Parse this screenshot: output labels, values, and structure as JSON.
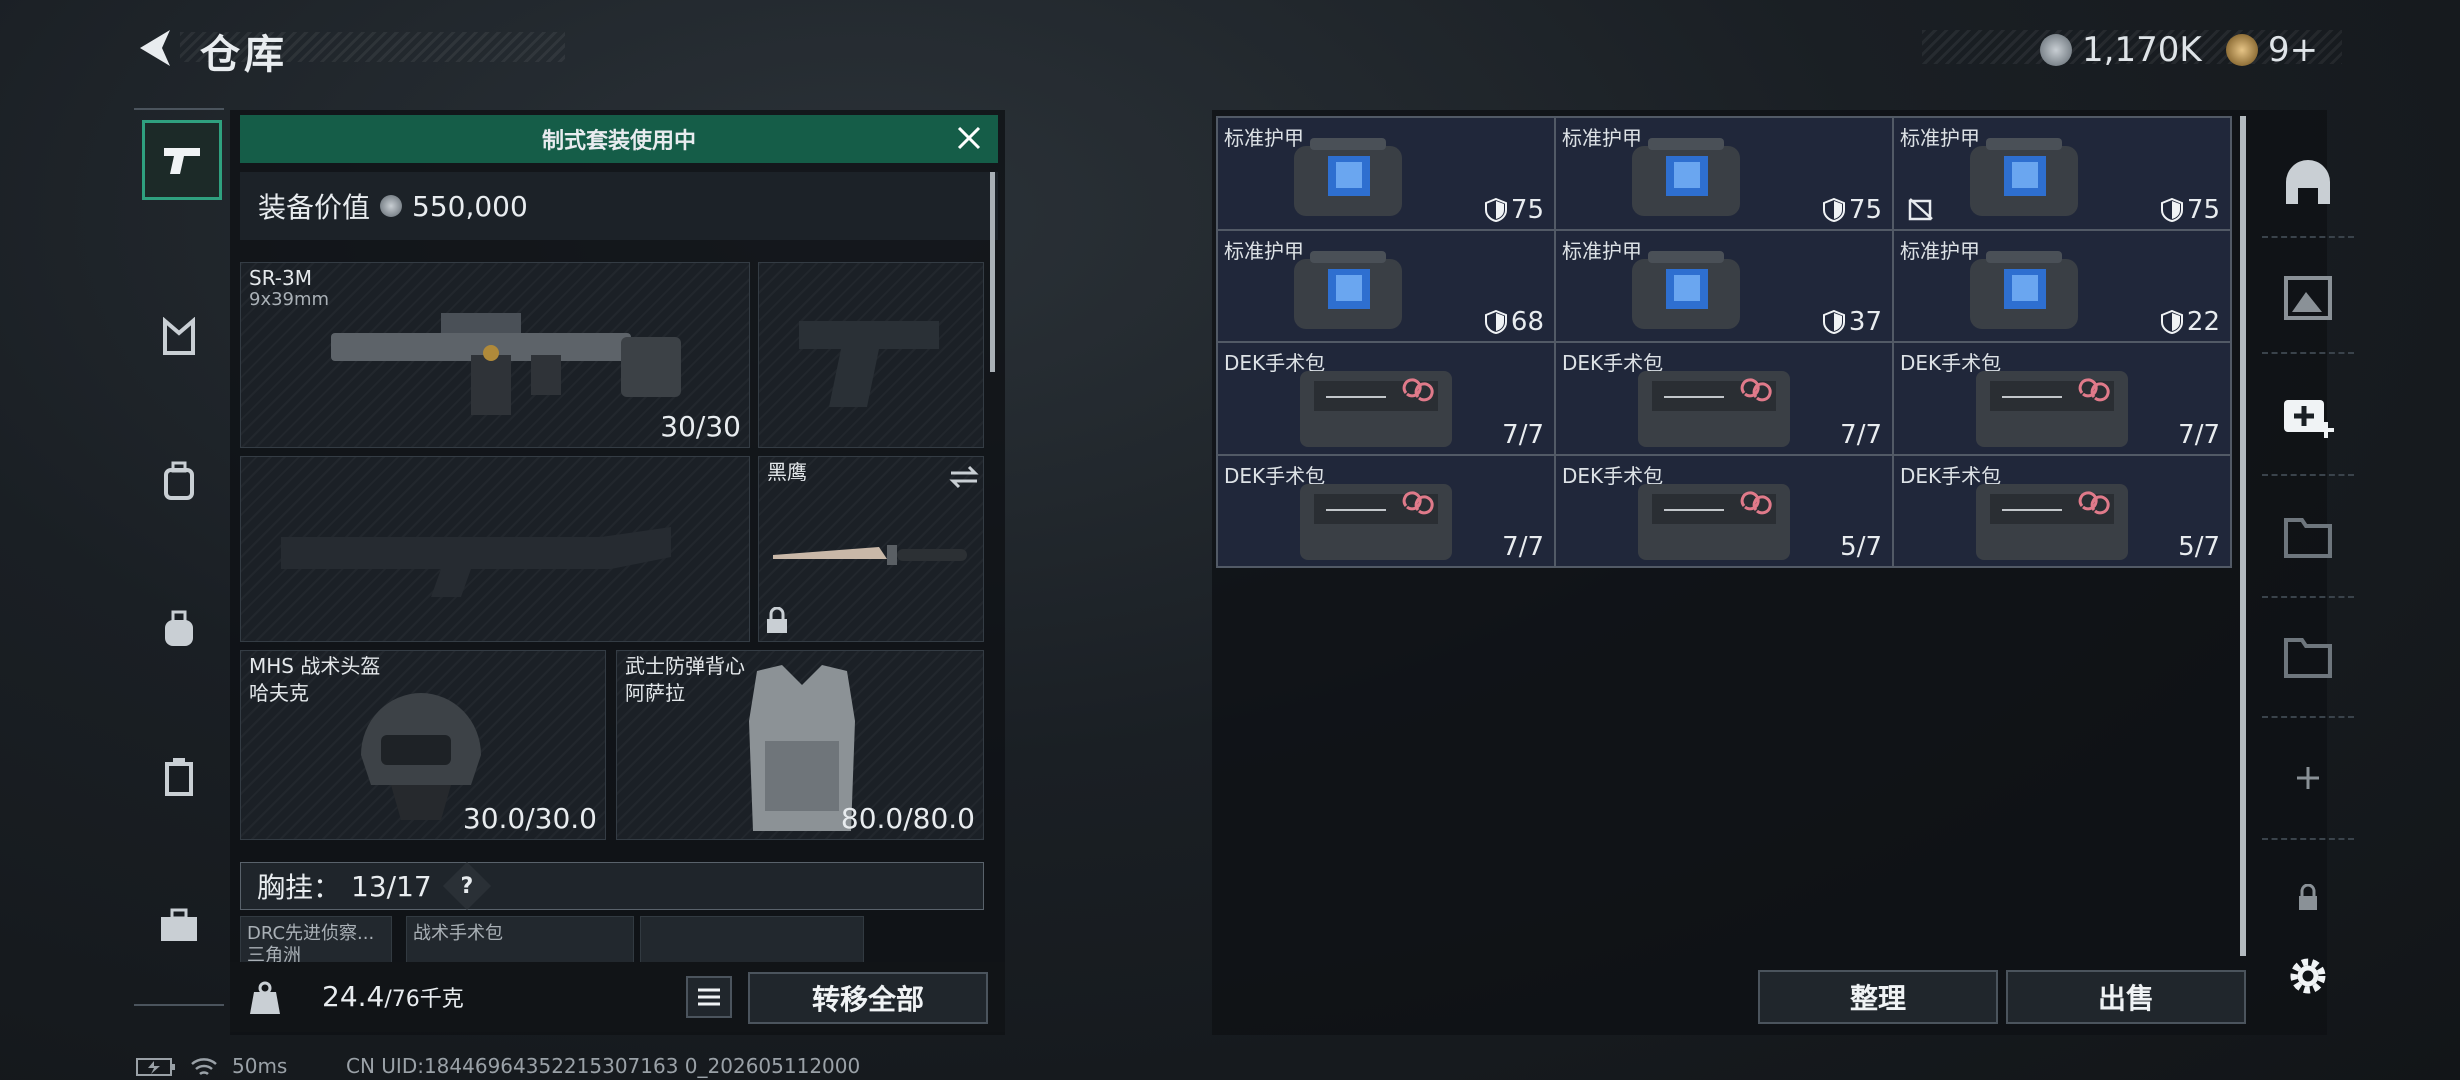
{
  "header": {
    "title": "仓库",
    "currency_amount": "1,170K",
    "token_count": "9+"
  },
  "loadout": {
    "banner": "制式套装使用中",
    "value_label": "装备价值",
    "value": "550,000",
    "primary": {
      "name": "SR-3M",
      "caliber": "9x39mm",
      "ammo": "30/30"
    },
    "melee": {
      "name": "黑鹰"
    },
    "helmet": {
      "line1": "MHS 战术头盔",
      "line2": "哈夫克",
      "durability": "30.0/30.0"
    },
    "armor": {
      "line1": "武士防弹背心",
      "line2": "阿萨拉",
      "durability": "80.0/80.0"
    },
    "chest_rig": {
      "label": "胸挂：",
      "count": "13/17",
      "help": "?"
    },
    "rig_items": [
      "DRC先进侦察...",
      "战术手术包"
    ],
    "rig_sub": "三角洲",
    "weight_current": "24.4",
    "weight_max": "/76千克",
    "transfer_button": "转移全部"
  },
  "stash": {
    "items": [
      {
        "name": "标准护甲",
        "type": "armor",
        "value": "75",
        "extra_icon": false
      },
      {
        "name": "标准护甲",
        "type": "armor",
        "value": "75",
        "extra_icon": false
      },
      {
        "name": "标准护甲",
        "type": "armor",
        "value": "75",
        "extra_icon": true
      },
      {
        "name": "标准护甲",
        "type": "armor",
        "value": "68",
        "extra_icon": false
      },
      {
        "name": "标准护甲",
        "type": "armor",
        "value": "37",
        "extra_icon": false
      },
      {
        "name": "标准护甲",
        "type": "armor",
        "value": "22",
        "extra_icon": false
      },
      {
        "name": "DEK手术包",
        "type": "medkit",
        "value": "7/7",
        "extra_icon": false
      },
      {
        "name": "DEK手术包",
        "type": "medkit",
        "value": "7/7",
        "extra_icon": false
      },
      {
        "name": "DEK手术包",
        "type": "medkit",
        "value": "7/7",
        "extra_icon": false
      },
      {
        "name": "DEK手术包",
        "type": "medkit",
        "value": "7/7",
        "extra_icon": false
      },
      {
        "name": "DEK手术包",
        "type": "medkit",
        "value": "5/7",
        "extra_icon": false
      },
      {
        "name": "DEK手术包",
        "type": "medkit",
        "value": "5/7",
        "extra_icon": false
      }
    ],
    "sort_button": "整理",
    "sell_button": "出售"
  },
  "status": {
    "ping": "50ms",
    "uid": "CN UID:18446964352215307163 0_202605112000"
  },
  "icons": {
    "left_nav": [
      "pistol-icon",
      "bandolier-icon",
      "backpack-tag-icon",
      "backpack-icon",
      "locker-icon",
      "briefcase-icon"
    ],
    "right_nav": [
      "dome-icon",
      "gallery-icon",
      "medkit-plus-icon",
      "folder-icon",
      "folder-icon",
      "plus-icon",
      "lock-icon",
      "gear-icon"
    ]
  },
  "colors": {
    "accent_green": "#155d48",
    "nav_active": "#2fa07f",
    "stash_cell": "#20273a"
  }
}
